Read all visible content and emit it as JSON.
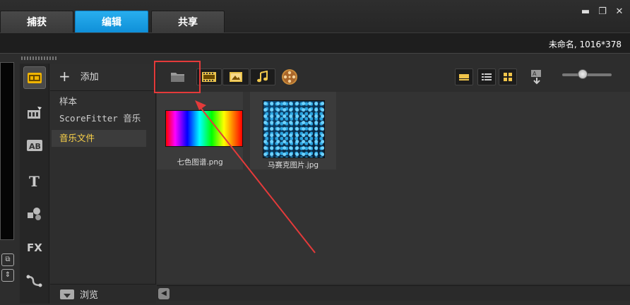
{
  "tabs": [
    {
      "label": "捕获",
      "active": false
    },
    {
      "label": "编辑",
      "active": true
    },
    {
      "label": "共享",
      "active": false
    }
  ],
  "window_controls": {
    "minimize": "▬",
    "restore": "❐",
    "close": "✕"
  },
  "project_info": "未命名, 1016*378",
  "library": {
    "add_label": "添加",
    "items": [
      {
        "label": "样本",
        "selected": false
      },
      {
        "label": "ScoreFitter 音乐",
        "selected": false
      },
      {
        "label": "音乐文件",
        "selected": true
      }
    ],
    "browse_label": "浏览"
  },
  "media_filters": [
    {
      "icon": "folder-icon",
      "label": ""
    },
    {
      "icon": "video-filter-icon",
      "label": ""
    },
    {
      "icon": "photo-filter-icon",
      "label": ""
    },
    {
      "icon": "audio-filter-icon",
      "label": ""
    },
    {
      "icon": "film-reel-icon",
      "label": ""
    }
  ],
  "media_items": [
    {
      "name": "七色图谱.png",
      "kind": "spectrum"
    },
    {
      "name": "马赛克图片.jpg",
      "kind": "mosaic"
    }
  ],
  "colors": {
    "active_tab": "#1a9be2",
    "highlight_box": "#e43a3a",
    "selected_item_text": "#ffd64a"
  }
}
